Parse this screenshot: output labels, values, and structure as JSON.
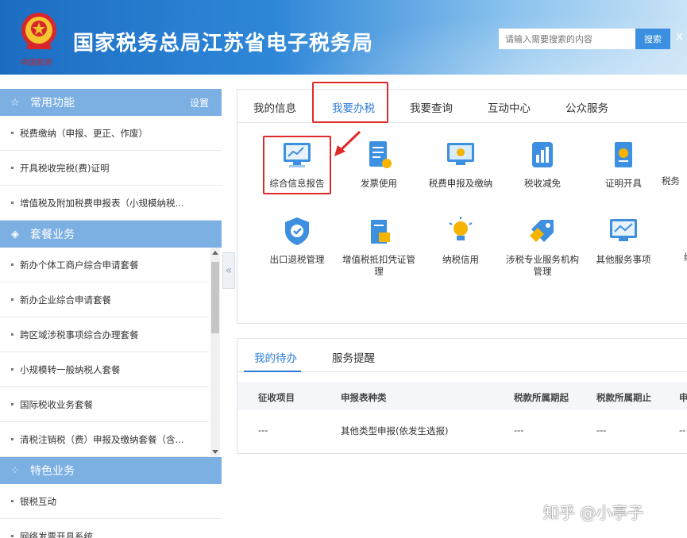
{
  "header": {
    "site_title": "国家税务总局江苏省电子税务局",
    "slogan": "中国税务",
    "search_placeholder": "请输入需要搜索的内容",
    "search_button": "搜索",
    "extra": "X"
  },
  "sidebar": {
    "common": {
      "title": "常用功能",
      "settings": "设置",
      "items": [
        "税费缴纳（申报、更正、作废）",
        "开具税收完税(费)证明",
        "增值税及附加税费申报表（小规模纳税..."
      ]
    },
    "package": {
      "title": "套餐业务",
      "items": [
        "新办个体工商户综合申请套餐",
        "新办企业综合申请套餐",
        "跨区域涉税事项综合办理套餐",
        "小规模转一般纳税人套餐",
        "国际税收业务套餐",
        "清税注销税（费）申报及缴纳套餐（含..."
      ]
    },
    "special": {
      "title": "特色业务",
      "items": [
        "银税互动",
        "网络发票开具系统"
      ]
    },
    "collapse": "«"
  },
  "main": {
    "tabs": [
      "我的信息",
      "我要办税",
      "我要查询",
      "互动中心",
      "公众服务"
    ],
    "active_tab": "我要办税",
    "tiles_row1": [
      "综合信息报告",
      "发票使用",
      "税费申报及缴纳",
      "税收减免",
      "证明开具",
      "税务"
    ],
    "tiles_row2": [
      "出口退税管理",
      "增值税抵扣凭证管理",
      "纳税信用",
      "涉税专业服务机构管理",
      "其他服务事项",
      "纳"
    ]
  },
  "pending": {
    "tabs": [
      "我的待办",
      "服务提醒"
    ],
    "columns": [
      "征收项目",
      "申报表种类",
      "税款所属期起",
      "税款所属期止",
      "申"
    ],
    "row": [
      "---",
      "其他类型申报(依发生选报)",
      "---",
      "---",
      "--"
    ]
  },
  "watermark": "知乎 @小亭子",
  "colors": {
    "accent": "#2b7bd6",
    "highlight": "#e02a2a",
    "sidebar_head": "#7cb0e3"
  }
}
